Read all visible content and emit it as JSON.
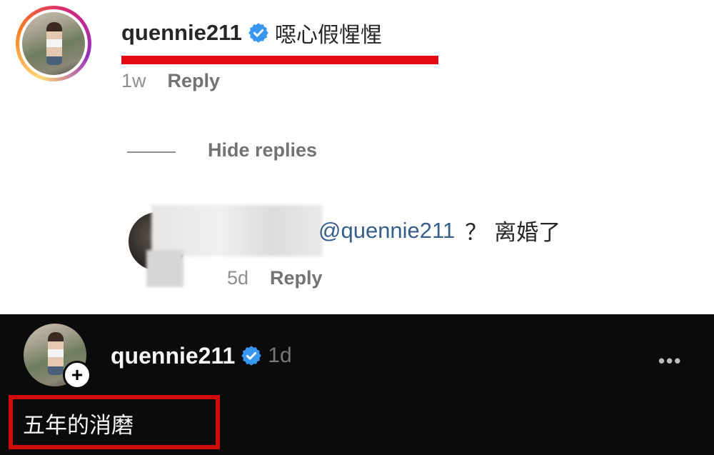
{
  "comment": {
    "username": "quennie211",
    "text": "噁心假惺惺",
    "time": "1w",
    "reply_label": "Reply",
    "hide_replies_label": "Hide replies"
  },
  "reply": {
    "mention": "@quennie211",
    "text": "？ 离婚了",
    "time": "5d",
    "reply_label": "Reply"
  },
  "post": {
    "username": "quennie211",
    "time": "1d",
    "more_label": "•••",
    "text": "五年的消磨",
    "add_label": "+"
  },
  "colors": {
    "verified": "#3897f0",
    "highlight_red": "#e50914",
    "mention_blue": "#365e8a",
    "dark_bg": "#0b0b0b"
  }
}
